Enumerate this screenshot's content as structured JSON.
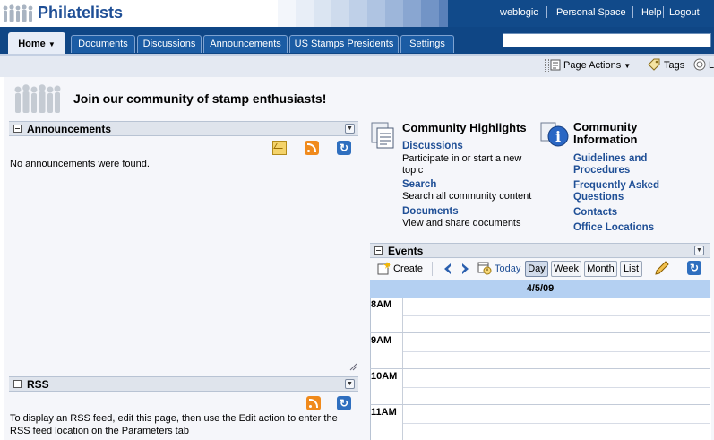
{
  "header": {
    "title": "Philatelists",
    "links": [
      "weblogic",
      "Personal Space",
      "Help",
      "Logout"
    ]
  },
  "tabs": [
    "Home",
    "Documents",
    "Discussions",
    "Announcements",
    "US Stamps Presidents",
    "Settings"
  ],
  "toolbar": {
    "page_actions": "Page Actions",
    "tags": "Tags",
    "cut_label": "L"
  },
  "banner": {
    "text": "Join our community of stamp enthusiasts!"
  },
  "announcements": {
    "title": "Announcements",
    "empty_text": "No announcements were found."
  },
  "rss": {
    "title": "RSS",
    "text": "To display an RSS feed, edit this page, then use the Edit action to enter the RSS feed location on the Parameters tab"
  },
  "community_highlights": {
    "title": "Community Highlights",
    "items": [
      {
        "label": "Discussions",
        "desc": "Participate in or start a new topic"
      },
      {
        "label": "Search",
        "desc": "Search all community content"
      },
      {
        "label": "Documents",
        "desc": "View and share documents"
      }
    ]
  },
  "community_info": {
    "title": "Community Information",
    "links": [
      "Guidelines and Procedures",
      "Frequently Asked Questions",
      "Contacts",
      "Office Locations"
    ]
  },
  "events": {
    "title": "Events",
    "create": "Create",
    "today": "Today",
    "views": [
      "Day",
      "Week",
      "Month",
      "List"
    ],
    "selected_view": "Day",
    "date": "4/5/09",
    "hours": [
      "8AM",
      "9AM",
      "10AM",
      "11AM"
    ]
  },
  "colors": {
    "brand_blue": "#1f4f96",
    "tab_bar": "#0f4685",
    "date_bar": "#b4d0f2"
  }
}
